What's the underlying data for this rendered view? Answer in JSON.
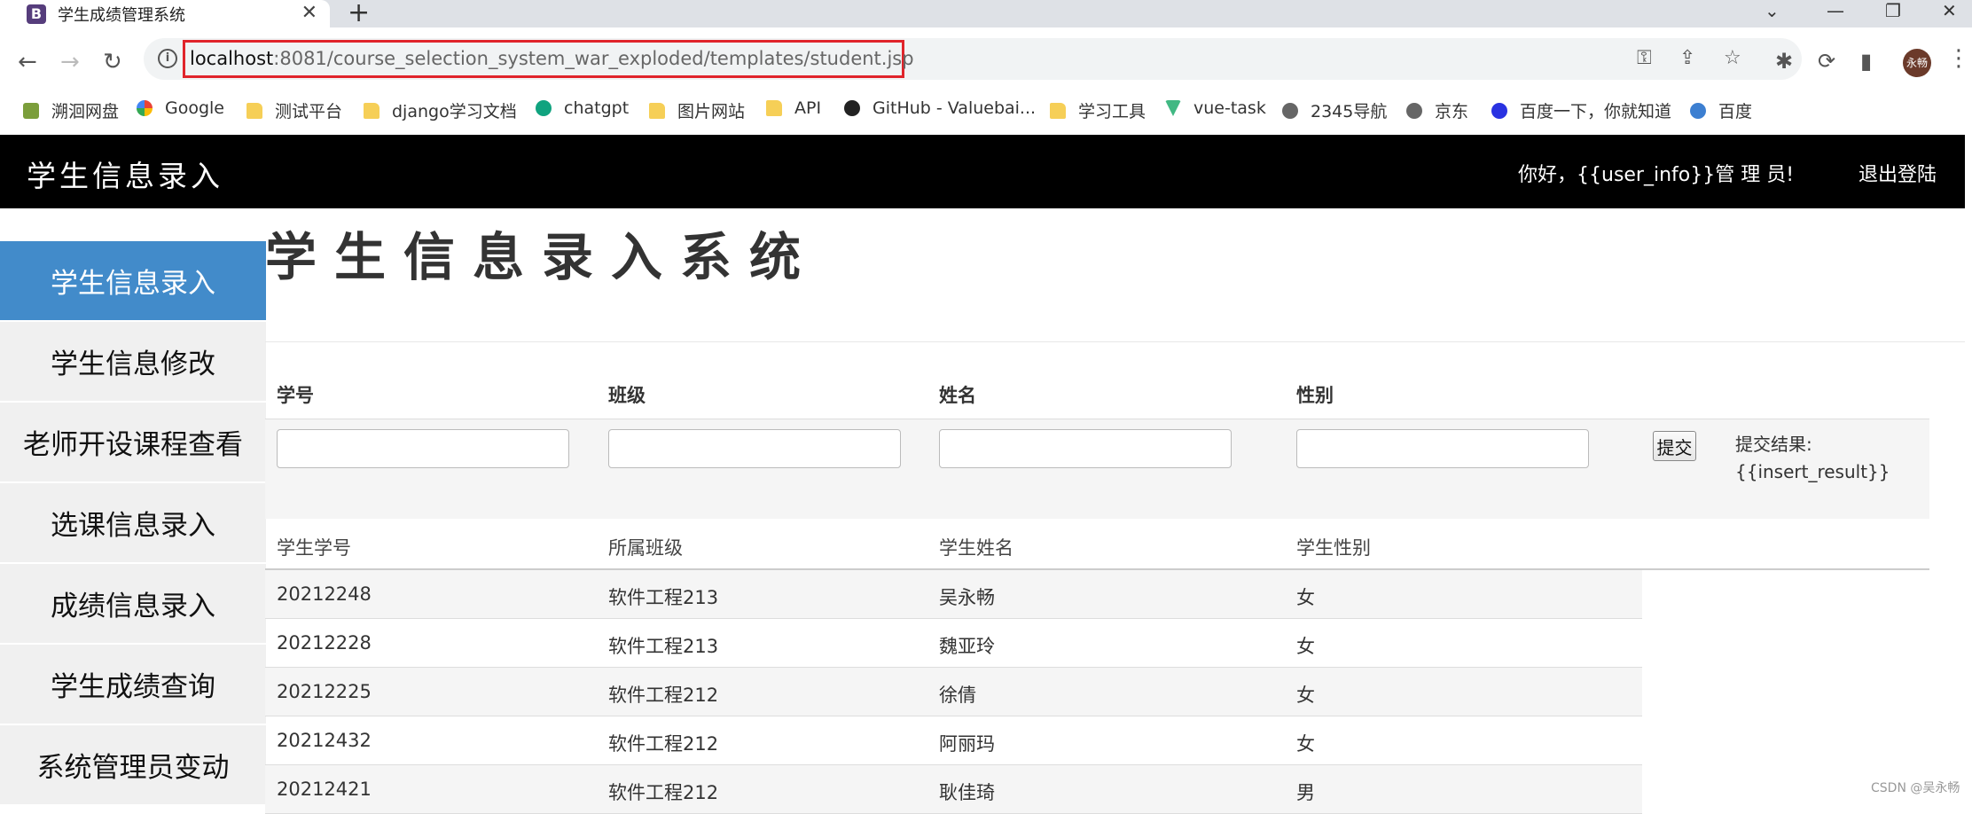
{
  "browser": {
    "tab_title": "学生成绩管理系统",
    "tab_favicon_letter": "B",
    "url_host": "localhost",
    "url_rest": ":8081/course_selection_system_war_exploded/templates/student.jsp",
    "profile_initials": "永畅",
    "bookmarks": [
      {
        "label": "溯洄网盘",
        "icon": "cloud-icon"
      },
      {
        "label": "Google",
        "icon": "google-icon"
      },
      {
        "label": "测试平台",
        "icon": "folder-icon"
      },
      {
        "label": "django学习文档",
        "icon": "folder-icon"
      },
      {
        "label": "chatgpt",
        "icon": "openai-icon"
      },
      {
        "label": "图片网站",
        "icon": "folder-icon"
      },
      {
        "label": "API",
        "icon": "folder-icon"
      },
      {
        "label": "GitHub - Valuebai...",
        "icon": "github-icon"
      },
      {
        "label": "学习工具",
        "icon": "folder-icon"
      },
      {
        "label": "vue-task",
        "icon": "vue-icon"
      },
      {
        "label": "2345导航",
        "icon": "globe-icon"
      },
      {
        "label": "京东",
        "icon": "globe-icon"
      },
      {
        "label": "百度一下，你就知道",
        "icon": "baidu-icon"
      },
      {
        "label": "百度",
        "icon": "baidu-icon"
      }
    ]
  },
  "navbar": {
    "brand": "学生信息录入",
    "greeting": "你好，{{user_info}}管 理 员!",
    "logout": "退出登陆"
  },
  "sidebar": {
    "items": [
      {
        "label": "学生信息录入",
        "active": true
      },
      {
        "label": "学生信息修改",
        "active": false
      },
      {
        "label": "老师开设课程查看",
        "active": false
      },
      {
        "label": "选课信息录入",
        "active": false
      },
      {
        "label": "成绩信息录入",
        "active": false
      },
      {
        "label": "学生成绩查询",
        "active": false
      },
      {
        "label": "系统管理员变动",
        "active": false
      }
    ]
  },
  "main": {
    "heading": "学生信息录入系统",
    "form": {
      "labels": [
        "学号",
        "班级",
        "姓名",
        "性别"
      ],
      "values": [
        "",
        "",
        "",
        ""
      ],
      "submit_label": "提交",
      "result_label": "提交结果:",
      "result_value": "{{insert_result}}"
    },
    "table": {
      "headers": [
        "学生学号",
        "所属班级",
        "学生姓名",
        "学生性别"
      ],
      "rows": [
        [
          "20212248",
          "软件工程213",
          "吴永畅",
          "女"
        ],
        [
          "20212228",
          "软件工程213",
          "魏亚玲",
          "女"
        ],
        [
          "20212225",
          "软件工程212",
          "徐倩",
          "女"
        ],
        [
          "20212432",
          "软件工程212",
          "阿丽玛",
          "女"
        ],
        [
          "20212421",
          "软件工程212",
          "耿佳琦",
          "男"
        ]
      ]
    }
  },
  "watermark": "CSDN @吴永畅",
  "colors": {
    "accent": "#428bca",
    "navbar": "#000000",
    "url_highlight": "#e0242b"
  }
}
